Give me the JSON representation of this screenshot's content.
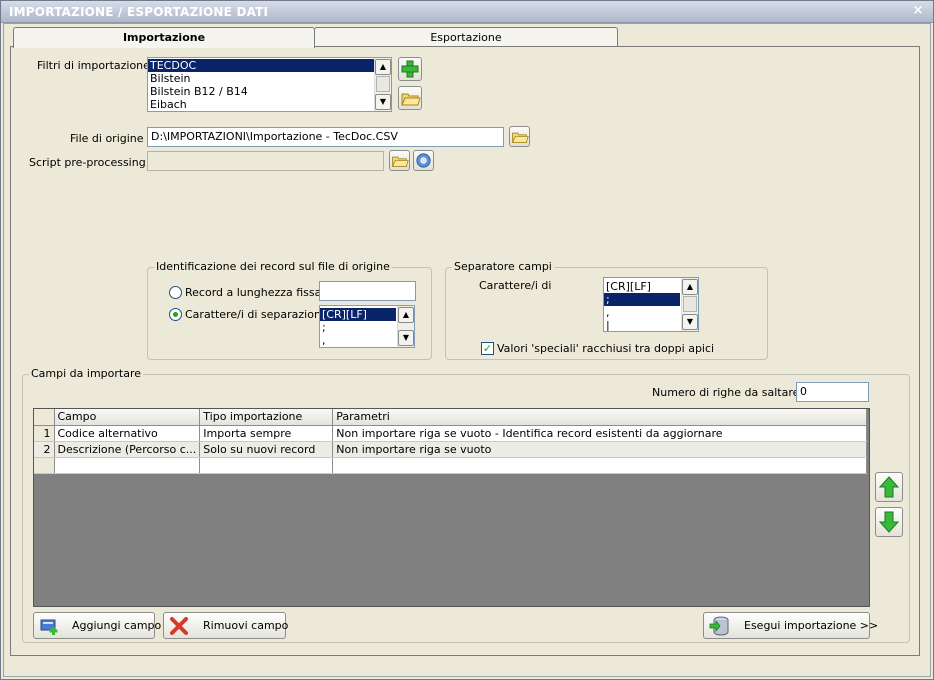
{
  "window": {
    "title": "IMPORTAZIONE / ESPORTAZIONE DATI",
    "close_glyph": "×"
  },
  "tabs": [
    {
      "label": "Importazione",
      "active": true
    },
    {
      "label": "Esportazione",
      "active": false
    }
  ],
  "filters": {
    "label": "Filtri di importazione :",
    "items": [
      "TECDOC",
      "Bilstein",
      "Bilstein B12 / B14",
      "Eibach"
    ],
    "selected": "TECDOC",
    "add_icon": "green-plus-icon",
    "open_icon": "folder-icon"
  },
  "source_file": {
    "label": "File di origine :",
    "value": "D:\\IMPORTAZIONI\\Importazione - TecDoc.CSV",
    "browse_icon": "folder-icon"
  },
  "script": {
    "label": "Script pre-processing :",
    "value": "",
    "browse_icon": "folder-icon",
    "help_icon": "help-icon"
  },
  "record_identification": {
    "title": "Identificazione dei record sul file di origine",
    "fixed_length_label": "Record a lunghezza fissa",
    "fixed_length_value": "",
    "separator_label": "Carattere/i di separazione",
    "separator_items": [
      "[CR][LF]",
      ";",
      ","
    ],
    "selected_option": "separator"
  },
  "field_separator": {
    "title": "Separatore campi",
    "chars_label": "Carattere/i di",
    "items": [
      "[CR][LF]",
      ";",
      ",",
      "|"
    ],
    "selected": ";",
    "quoted_label": "Valori 'speciali' racchiusi tra doppi apici",
    "quoted_checked": true
  },
  "fields": {
    "title": "Campi da importare",
    "skip_rows_label": "Numero di righe da saltare :",
    "skip_rows_value": "0",
    "columns": [
      "Campo",
      "Tipo importazione",
      "Parametri"
    ],
    "rows": [
      {
        "n": "1",
        "campo": "Codice alternativo",
        "tipo": "Importa sempre",
        "parametri": "Non importare riga se vuoto - Identifica record esistenti da aggiornare"
      },
      {
        "n": "2",
        "campo": "Descrizione (Percorso c...",
        "tipo": "Solo su nuovi record",
        "parametri": "Non importare riga se vuoto"
      }
    ]
  },
  "buttons": {
    "add_field": "Aggiungi campo",
    "remove_field": "Rimuovi campo",
    "run_import": "Esegui importazione >>"
  },
  "colors": {
    "selection": "#0a246a",
    "arrow_green": "#2fa52f",
    "remove_red": "#d83a2a"
  }
}
